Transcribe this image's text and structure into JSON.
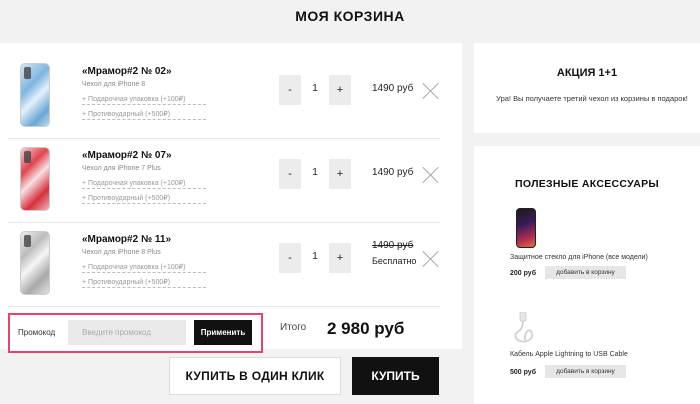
{
  "page_title": "МОЯ КОРЗИНА",
  "cart": {
    "items": [
      {
        "name": "«Мрамор#2 № 02»",
        "model": "Чехол для iPhone 8",
        "option1": "+ Подарочная упаковка (+100₽)",
        "option2": "+ Противоударный (+500₽)",
        "qty_minus": "-",
        "qty": "1",
        "qty_plus": "+",
        "price": "1490 руб",
        "color": "#7fb6e0"
      },
      {
        "name": "«Мрамор#2 № 07»",
        "model": "Чехол для iPhone 7 Plus",
        "option1": "+ Подарочная упаковка (+100₽)",
        "option2": "+ Противоударный (+500₽)",
        "qty_minus": "-",
        "qty": "1",
        "qty_plus": "+",
        "price": "1490 руб",
        "color": "#e0454f"
      },
      {
        "name": "«Мрамор#2 № 11»",
        "model": "Чехол для iPhone 8 Plus",
        "option1": "+ Подарочная упаковка (+100₽)",
        "option2": "+ Противоударный (+500₽)",
        "qty_minus": "-",
        "qty": "1",
        "qty_plus": "+",
        "price": "1490 руб",
        "price_note": "Бесплатно",
        "color": "#c9c9c9"
      }
    ]
  },
  "promo_code": {
    "label": "Промокод",
    "placeholder": "Введите промокод",
    "apply": "Применить",
    "highlight_color": "#e8436f"
  },
  "total": {
    "label": "Итого",
    "value": "2 980 руб"
  },
  "buttons": {
    "one_click": "КУПИТЬ В ОДИН КЛИК",
    "buy": "КУПИТЬ"
  },
  "offer": {
    "title": "АКЦИЯ 1+1",
    "text": "Ура! Вы получаете третий чехол из корзины в подарок!"
  },
  "accessories": {
    "title": "ПОЛЕЗНЫЕ АКСЕССУАРЫ",
    "items": [
      {
        "name": "Защитное стекло для iPhone (все модели)",
        "price": "200 руб",
        "add": "добавить в корзину"
      },
      {
        "name": "Кабель Apple Lightning to USB Cable",
        "price": "500 руб",
        "add": "добавить в корзину"
      }
    ]
  }
}
